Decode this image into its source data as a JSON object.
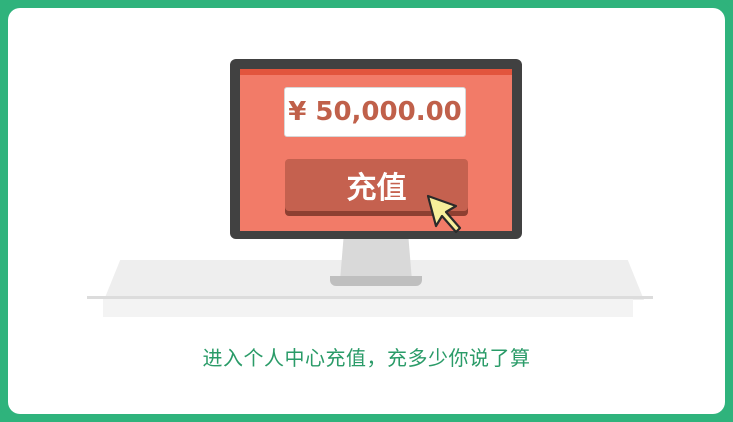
{
  "screen": {
    "amount": "¥ 50,000.00",
    "button_label": "充值"
  },
  "caption": "进入个人中心充值，充多少你说了算",
  "icons": {
    "cursor": "hand-pointer-icon"
  },
  "colors": {
    "frame": "#2fb37c",
    "screen": "#f27b68",
    "button": "#c5614f",
    "amount_text": "#c0604a",
    "caption_text": "#2a9b68"
  }
}
